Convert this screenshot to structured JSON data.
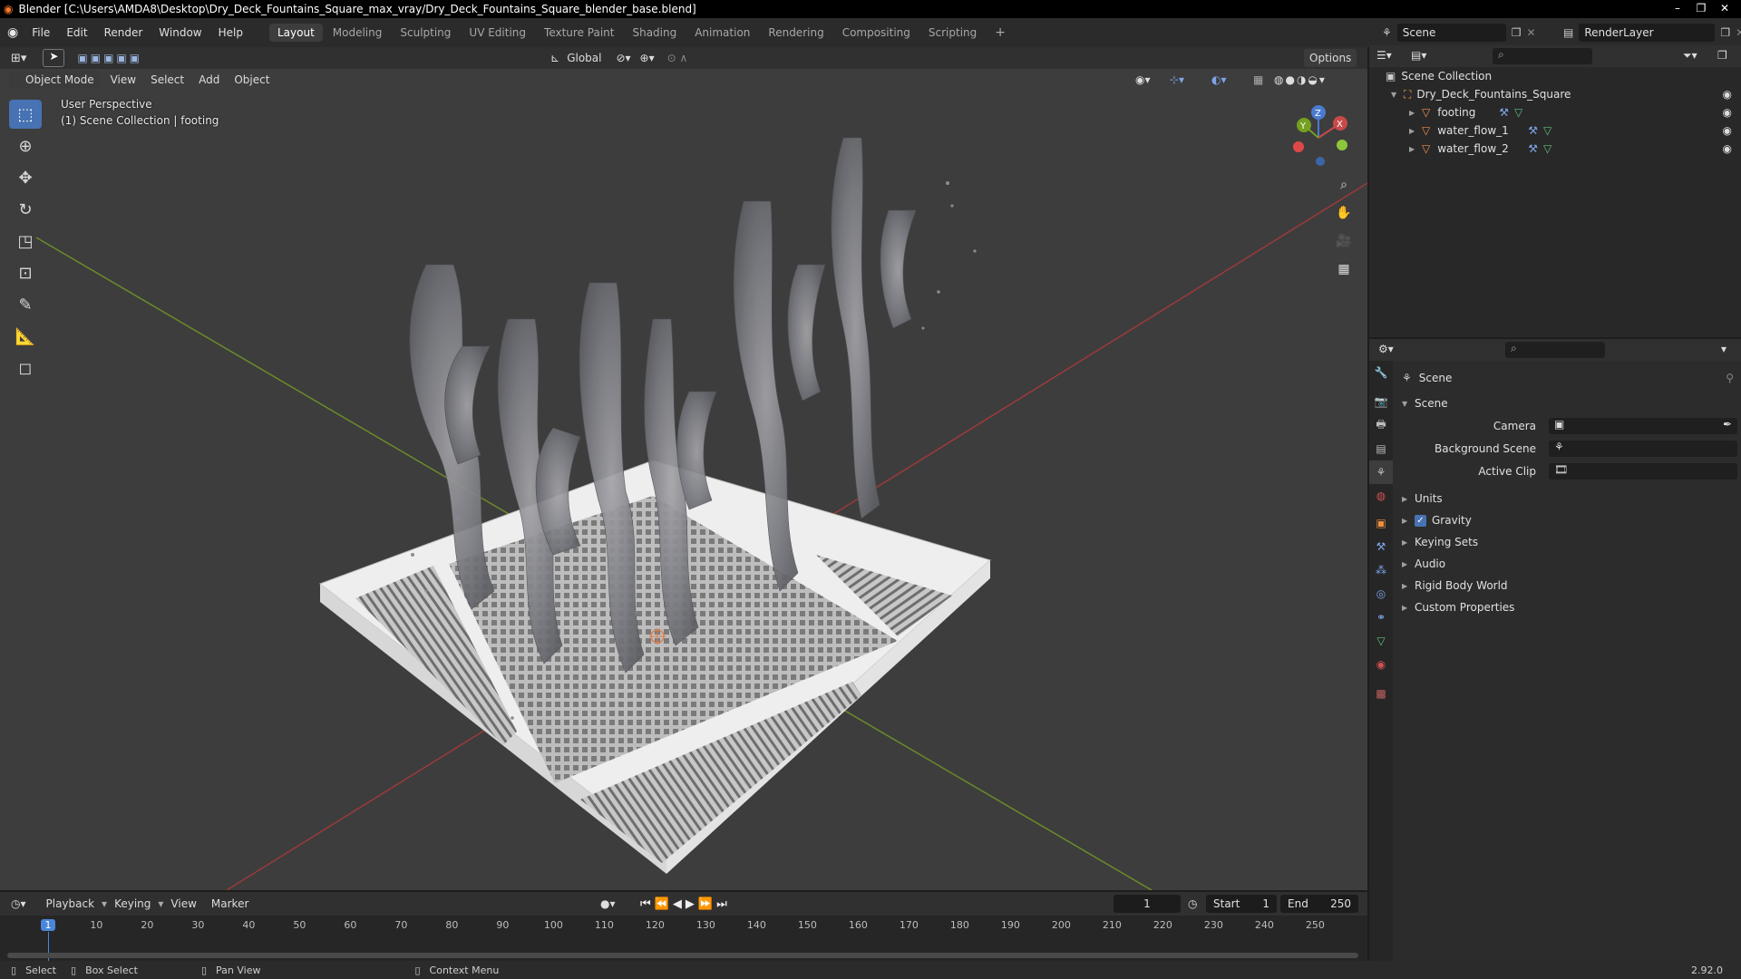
{
  "window": {
    "title": "Blender [C:\\Users\\AMDA8\\Desktop\\Dry_Deck_Fountains_Square_max_vray/Dry_Deck_Fountains_Square_blender_base.blend]",
    "min": "–",
    "max": "❐",
    "close": "✕"
  },
  "menu": [
    "File",
    "Edit",
    "Render",
    "Window",
    "Help"
  ],
  "workspaces": [
    "Layout",
    "Modeling",
    "Sculpting",
    "UV Editing",
    "Texture Paint",
    "Shading",
    "Animation",
    "Rendering",
    "Compositing",
    "Scripting"
  ],
  "add_workspace": "+",
  "scene_field": "Scene",
  "renderlayer_field": "RenderLayer",
  "viewport": {
    "mode": "Object Mode",
    "menus": [
      "View",
      "Select",
      "Add",
      "Object"
    ],
    "orientation": "Global",
    "options": "Options",
    "overlay_line1": "User Perspective",
    "overlay_line2": "(1) Scene Collection | footing",
    "gizmo": {
      "z": "Z",
      "y": "Y",
      "x": "X"
    },
    "background": "#3d3d3d",
    "grid_x_color": "#9b3a3a",
    "grid_y_color": "#6b8b2a"
  },
  "timeline": {
    "menus": [
      "Playback",
      "Keying",
      "View",
      "Marker"
    ],
    "current_frame": "1",
    "start_label": "Start",
    "start": "1",
    "end_label": "End",
    "end": "250",
    "ticks": [
      "1",
      "10",
      "20",
      "30",
      "40",
      "50",
      "60",
      "70",
      "80",
      "90",
      "100",
      "110",
      "120",
      "130",
      "140",
      "150",
      "160",
      "170",
      "180",
      "190",
      "200",
      "210",
      "220",
      "230",
      "240",
      "250"
    ]
  },
  "statusbar": {
    "select": "Select",
    "box_select": "Box Select",
    "pan_view": "Pan View",
    "context_menu": "Context Menu",
    "version": "2.92.0"
  },
  "outliner": {
    "root": "Scene Collection",
    "collection": "Dry_Deck_Fountains_Square",
    "objects": [
      "footing",
      "water_flow_1",
      "water_flow_2"
    ]
  },
  "properties": {
    "context": "Scene",
    "panel": "Scene",
    "fields": [
      {
        "label": "Camera",
        "value": ""
      },
      {
        "label": "Background Scene",
        "value": ""
      },
      {
        "label": "Active Clip",
        "value": ""
      }
    ],
    "subpanels": [
      "Units",
      "Gravity",
      "Keying Sets",
      "Audio",
      "Rigid Body World",
      "Custom Properties"
    ],
    "gravity_checked": true
  }
}
